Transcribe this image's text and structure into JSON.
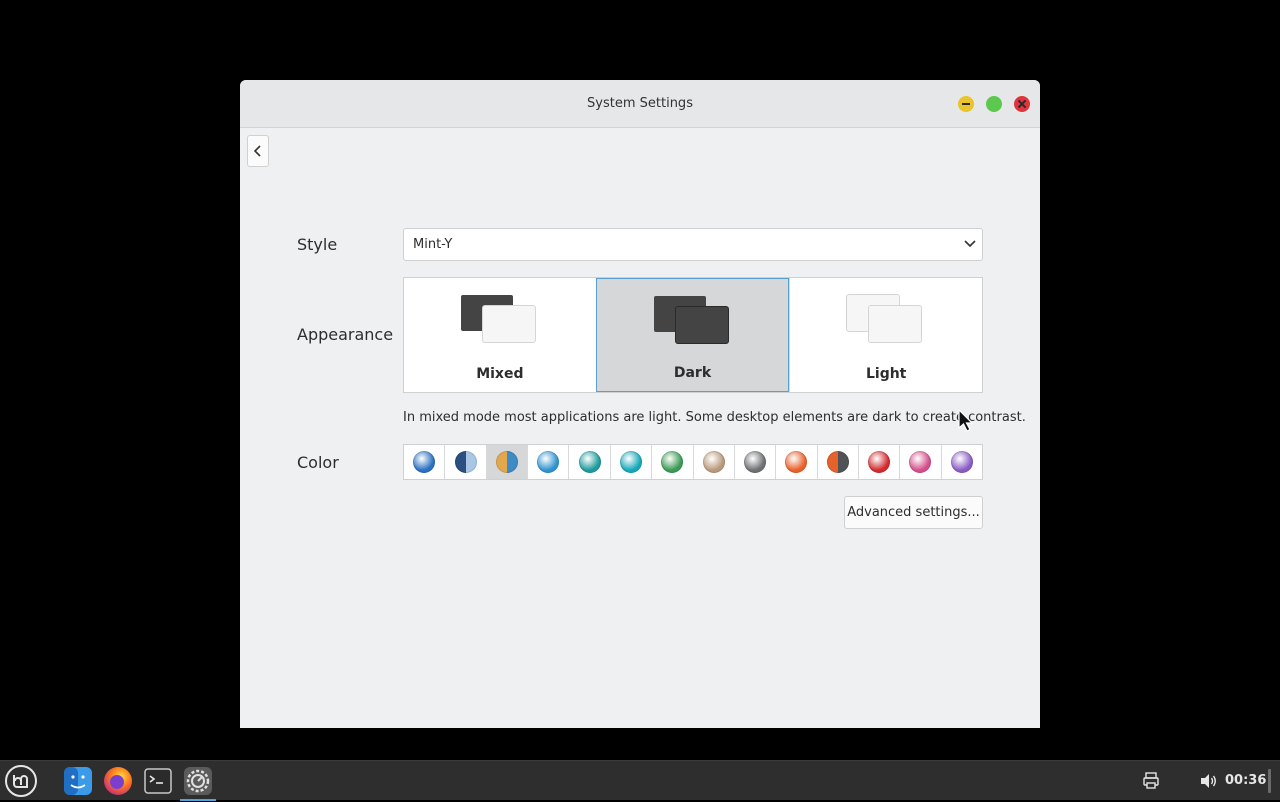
{
  "window": {
    "title": "System Settings",
    "controls": [
      "minimize-icon",
      "maximize-icon",
      "close-icon"
    ]
  },
  "nav": {
    "back_icon": "chevron-left-icon"
  },
  "style": {
    "label": "Style",
    "selected": "Mint-Y"
  },
  "appearance": {
    "label": "Appearance",
    "options": [
      {
        "label": "Mixed",
        "selected": false
      },
      {
        "label": "Dark",
        "selected": true
      },
      {
        "label": "Light",
        "selected": false
      }
    ],
    "description": "In mixed mode most applications are light. Some desktop elements are dark to create contrast."
  },
  "color": {
    "label": "Color",
    "selected_index": 2,
    "swatches": [
      "#2a70c0",
      "#2a4f80/#a9c7e4",
      "#e3a84e/#3e8cc6",
      "#2f93cf",
      "#1e9a9b",
      "#15a8b8",
      "#3a9a55",
      "#b8997a",
      "#6d6f73",
      "#e8602a",
      "#e8602a/#505356",
      "#d22a2e",
      "#d34f8b",
      "#8a5bc6"
    ]
  },
  "advanced_button": "Advanced settings...",
  "taskbar": {
    "launchers": [
      "mint-menu-icon",
      "file-manager-icon",
      "firefox-icon",
      "terminal-icon",
      "settings-icon"
    ],
    "tray": [
      "printer-icon",
      "volume-icon"
    ],
    "clock": "00:36"
  },
  "colors": {
    "accent": "#5a9fd4",
    "window_bg": "#eff0f1",
    "panel_bg": "#2e2e2e"
  }
}
